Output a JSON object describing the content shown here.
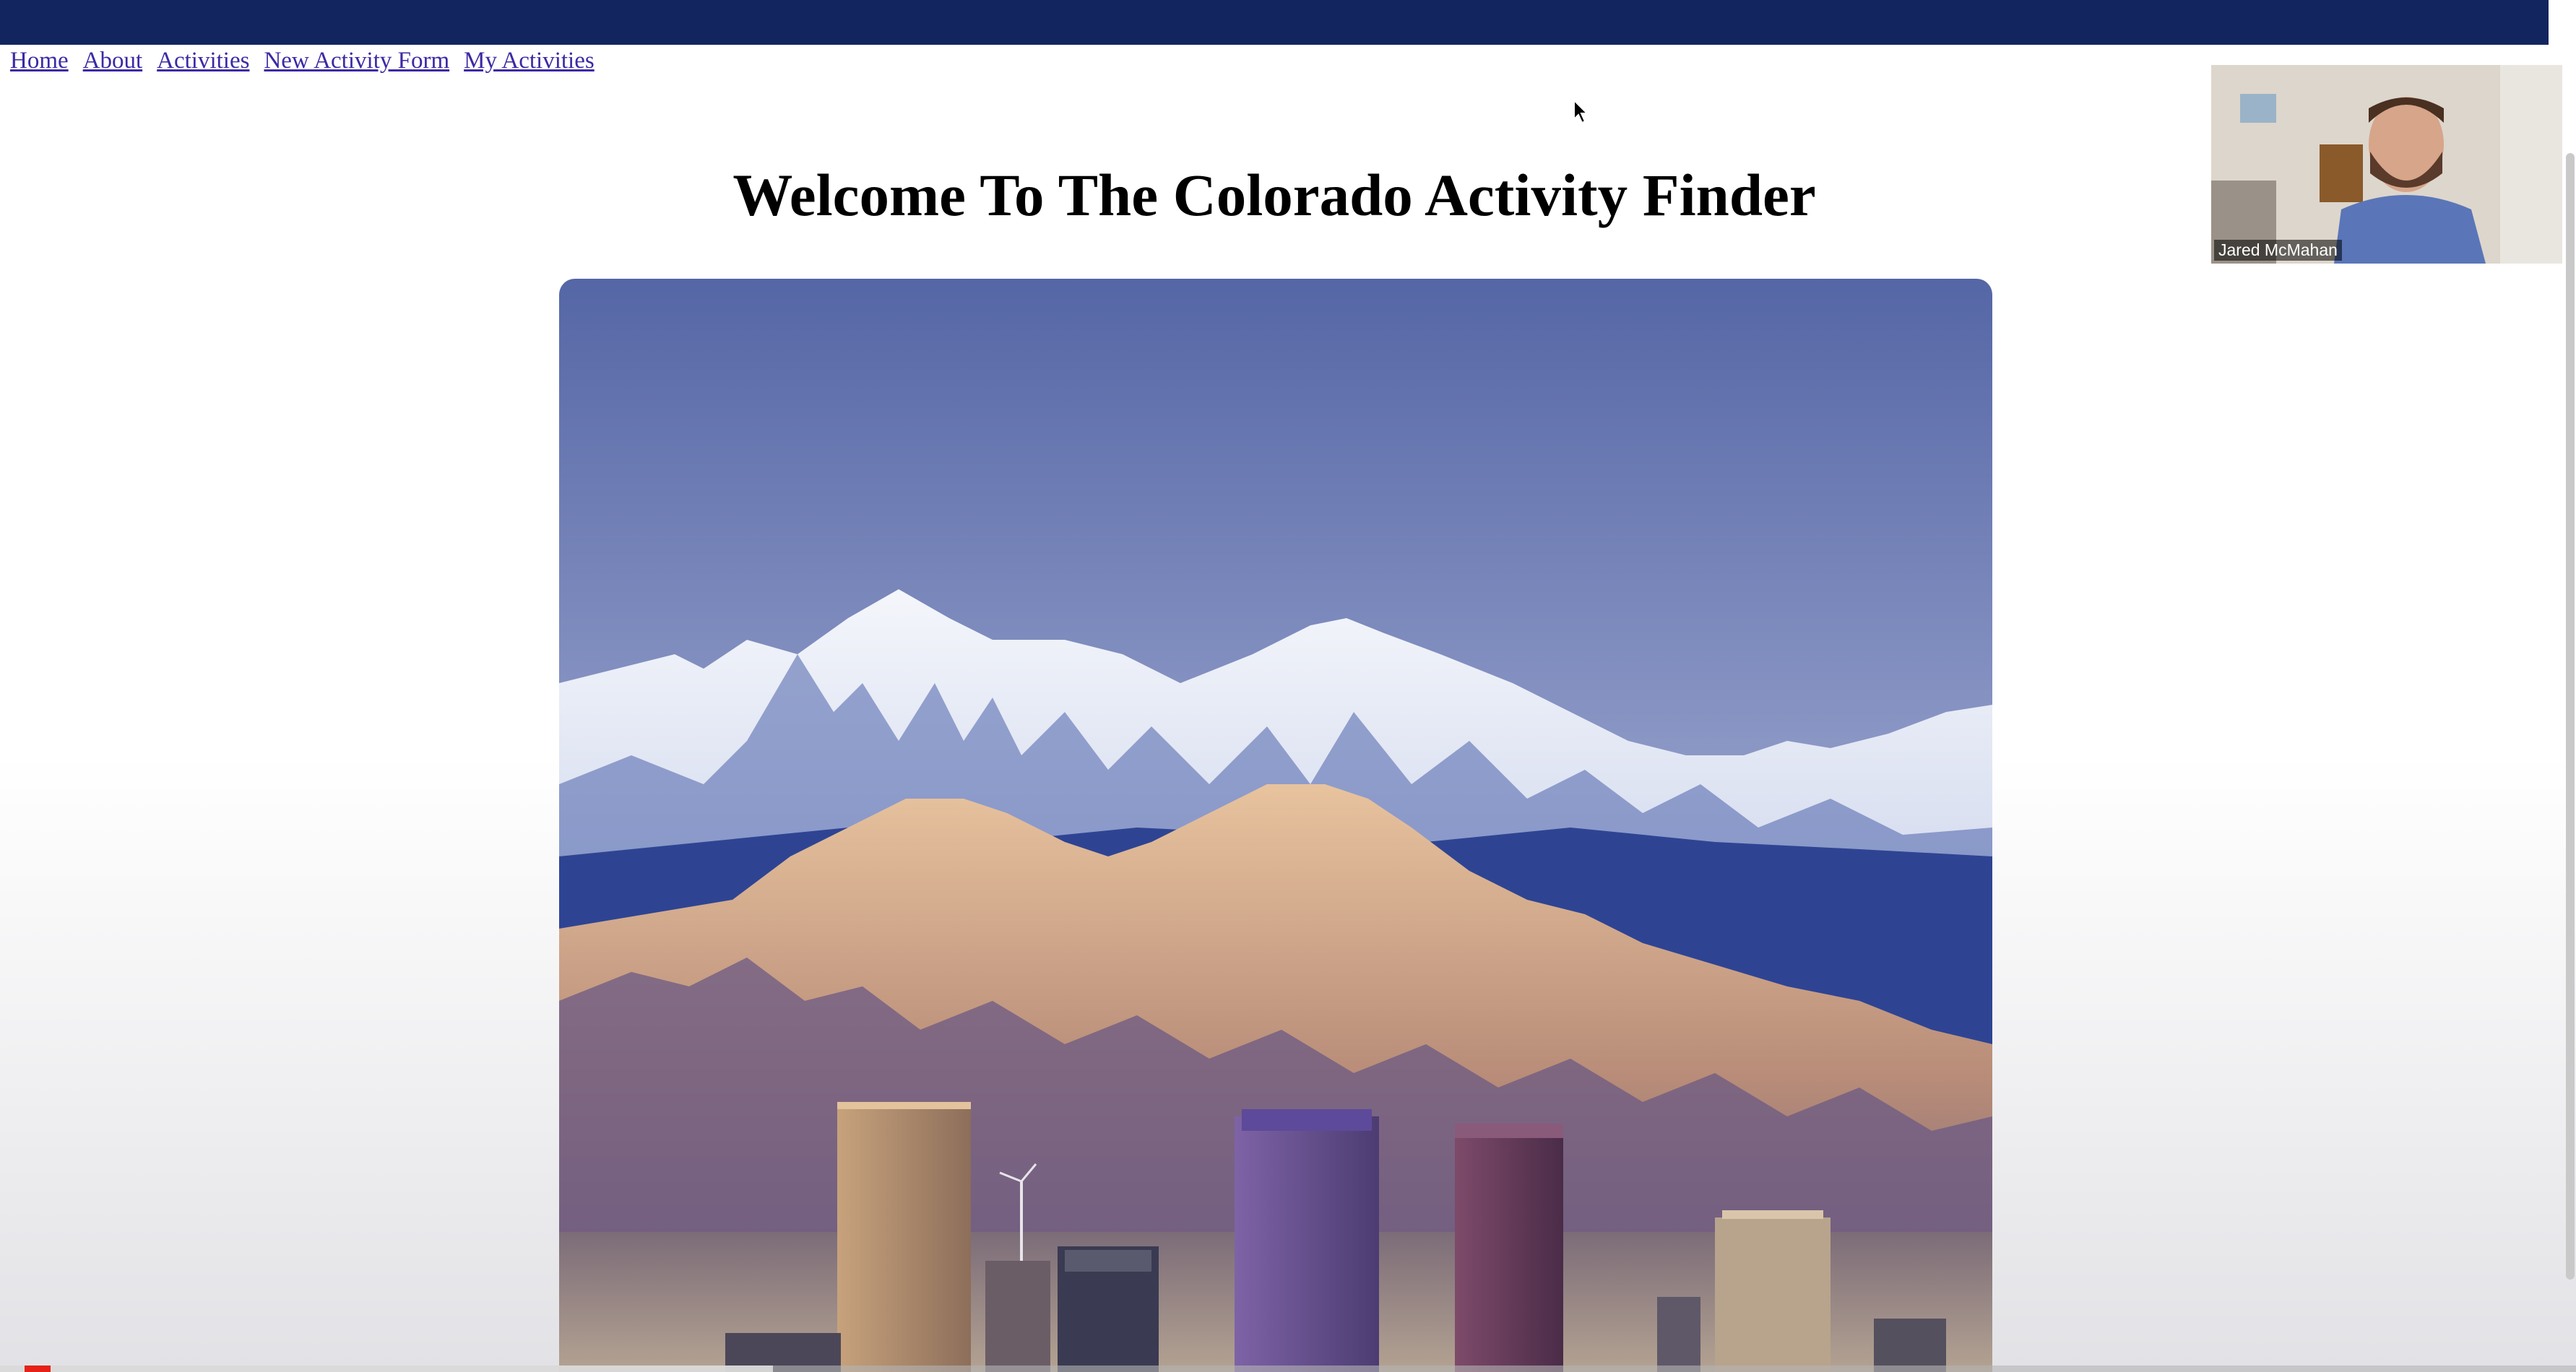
{
  "nav": {
    "links": [
      "Home",
      "About",
      "Activities",
      "New Activity Form",
      "My Activities"
    ]
  },
  "page": {
    "title": "Welcome To The Colorado Activity Finder",
    "hero_alt": "Denver skyline in front of snow-capped Rocky Mountains"
  },
  "video_overlay": {
    "participant_name": "Jared McMahan"
  },
  "player": {
    "progress_fraction": 0.3
  },
  "colors": {
    "topbar": "#13255e",
    "link": "#3b2aa5",
    "progress": "#e62117"
  },
  "icons": {
    "cursor": "mouse-pointer-icon"
  }
}
